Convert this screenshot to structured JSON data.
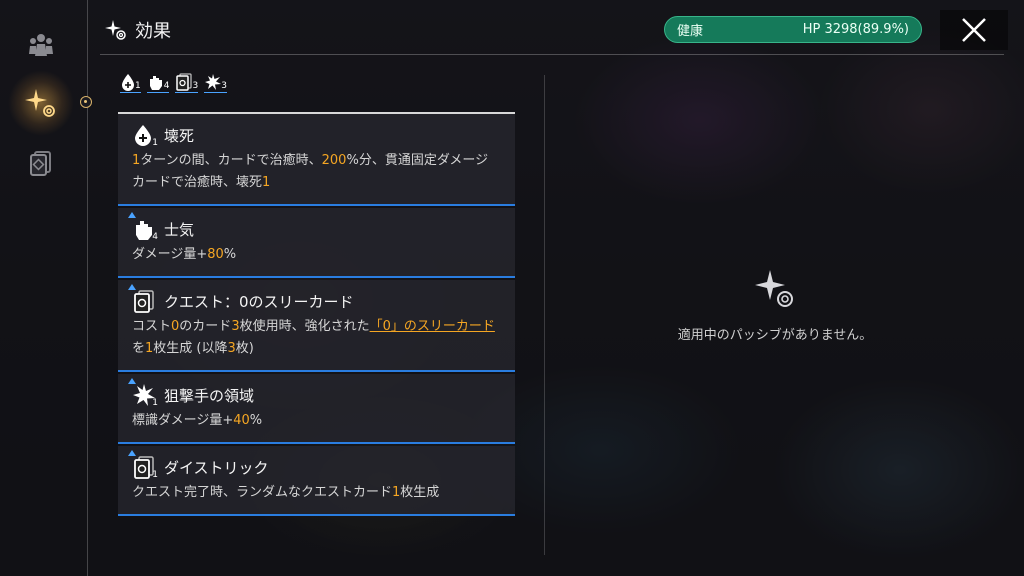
{
  "header": {
    "title": "効果"
  },
  "status": {
    "state": "健康",
    "hp": "HP 3298(89.9%)"
  },
  "summary_chips": [
    {
      "icon": "blood-drop-icon",
      "count": "1"
    },
    {
      "icon": "fist-icon",
      "count": "4"
    },
    {
      "icon": "card-icon",
      "count": "3"
    },
    {
      "icon": "burst-icon",
      "count": "3"
    }
  ],
  "effects": [
    {
      "title": "壊死",
      "icon": "blood-drop-icon",
      "count": "1",
      "desc": [
        "1",
        "ターンの間、カードで治癒時、",
        "200",
        "%分、貫通固定ダメージ",
        "カードで治癒時、壊死",
        "1"
      ]
    },
    {
      "title": "士気",
      "icon": "fist-icon",
      "count": "4",
      "desc": [
        "ダメージ量+",
        "80",
        "%"
      ]
    },
    {
      "title": "クエスト：0のスリーカード",
      "icon": "card-icon",
      "count": "",
      "desc": [
        "コスト",
        "0",
        "のカード",
        "3",
        "枚使用時、強化された",
        "「0」のスリーカード",
        "を",
        "1",
        "枚生成 (以降",
        "3",
        "枚)"
      ]
    },
    {
      "title": "狙撃手の領域",
      "icon": "burst-icon",
      "count": "1",
      "desc": [
        "標識ダメージ量+",
        "40",
        "%"
      ]
    },
    {
      "title": "ダイストリック",
      "icon": "card-icon",
      "count": "1",
      "desc": [
        "クエスト完了時、ランダムなクエストカード",
        "1",
        "枚生成"
      ]
    }
  ],
  "passive": {
    "empty_text": "適用中のパッシブがありません。"
  },
  "colors": {
    "accent": "#f5a623",
    "hp_green": "#157a5a",
    "rule_blue": "#2a7de0"
  }
}
